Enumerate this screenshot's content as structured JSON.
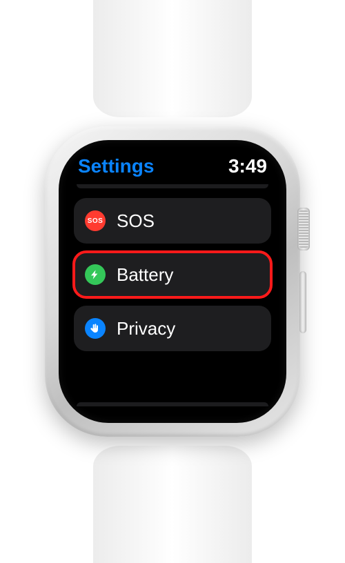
{
  "status": {
    "title": "Settings",
    "time": "3:49"
  },
  "rows": [
    {
      "id": "sos",
      "label": "SOS",
      "icon": "sos-icon",
      "icon_text": "SOS",
      "color": "#ff3b30",
      "highlighted": false
    },
    {
      "id": "battery",
      "label": "Battery",
      "icon": "bolt-icon",
      "icon_text": "",
      "color": "#34c759",
      "highlighted": true
    },
    {
      "id": "privacy",
      "label": "Privacy",
      "icon": "hand-icon",
      "icon_text": "",
      "color": "#0a84ff",
      "highlighted": false
    }
  ]
}
